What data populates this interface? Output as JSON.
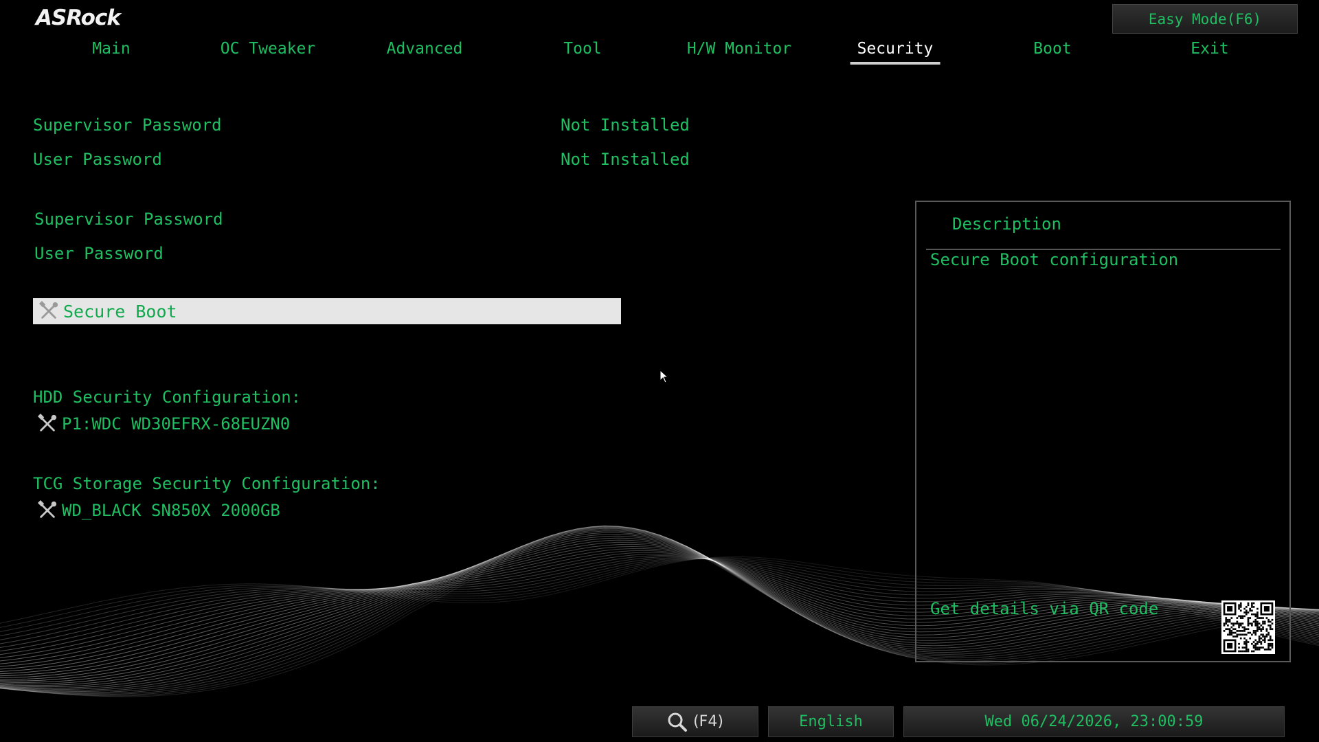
{
  "brand": {
    "logo_text": "ASRock"
  },
  "header": {
    "easy_mode_label": "Easy Mode(F6)"
  },
  "nav": {
    "tabs": [
      {
        "label": "Main"
      },
      {
        "label": "OC Tweaker"
      },
      {
        "label": "Advanced"
      },
      {
        "label": "Tool"
      },
      {
        "label": "H/W Monitor"
      },
      {
        "label": "Security",
        "active": true
      },
      {
        "label": "Boot"
      },
      {
        "label": "Exit"
      }
    ]
  },
  "status": {
    "supervisor_label": "Supervisor Password",
    "supervisor_value": "Not Installed",
    "user_label": "User Password",
    "user_value": "Not Installed"
  },
  "settings": {
    "set_supervisor_label": "Supervisor Password",
    "set_user_label": "User Password",
    "secure_boot_label": "Secure Boot"
  },
  "hdd": {
    "heading": "HDD Security Configuration:",
    "device": "P1:WDC WD30EFRX-68EUZN0"
  },
  "tcg": {
    "heading": "TCG Storage Security Configuration:",
    "device": "WD_BLACK SN850X 2000GB"
  },
  "description": {
    "title": "Description",
    "text": "Secure Boot configuration",
    "qr_text": "Get details via QR code"
  },
  "footer": {
    "search_label": "(F4)",
    "language": "English",
    "datetime": "Wed 06/24/2026, 23:00:59"
  },
  "colors": {
    "text_green": "#1fbf62",
    "highlight_bg": "#e6e6e6",
    "active_tab": "#ffffff"
  }
}
